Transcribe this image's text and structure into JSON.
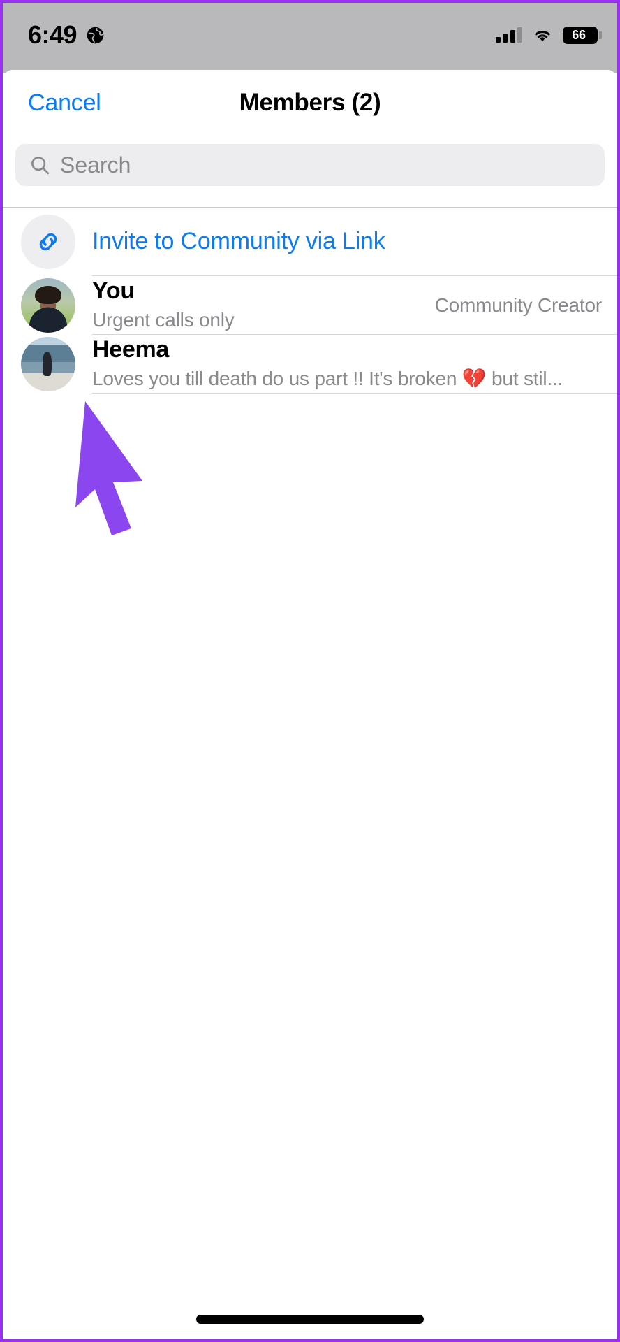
{
  "status_bar": {
    "time": "6:49",
    "globe_icon": "globe-icon",
    "signal_icon": "cellular-signal-icon",
    "signal_bars_filled": 3,
    "signal_bars_total": 4,
    "wifi_icon": "wifi-icon",
    "battery_icon": "battery-icon",
    "battery_level": "66"
  },
  "header": {
    "cancel_label": "Cancel",
    "title": "Members (2)"
  },
  "search": {
    "placeholder": "Search",
    "value": "",
    "icon": "search-icon"
  },
  "invite": {
    "label": "Invite to Community via Link",
    "icon": "link-icon"
  },
  "members": [
    {
      "name": "You",
      "status": "Urgent calls only",
      "role": "Community Creator",
      "avatar": "avatar-you"
    },
    {
      "name": "Heema",
      "status": "Loves you till death do us part !! It's broken 💔 but stil...",
      "role": "",
      "avatar": "avatar-heema"
    }
  ],
  "annotation": {
    "pointer_icon": "arrow-cursor-icon",
    "pointer_color": "#8b46f0"
  },
  "colors": {
    "accent_blue": "#067cf7",
    "border_purple": "#9b30f0",
    "status_bar_bg": "#b9b9bc",
    "search_bg": "#ededef",
    "muted_text": "#8a8a8e"
  },
  "home_indicator": "home-indicator"
}
